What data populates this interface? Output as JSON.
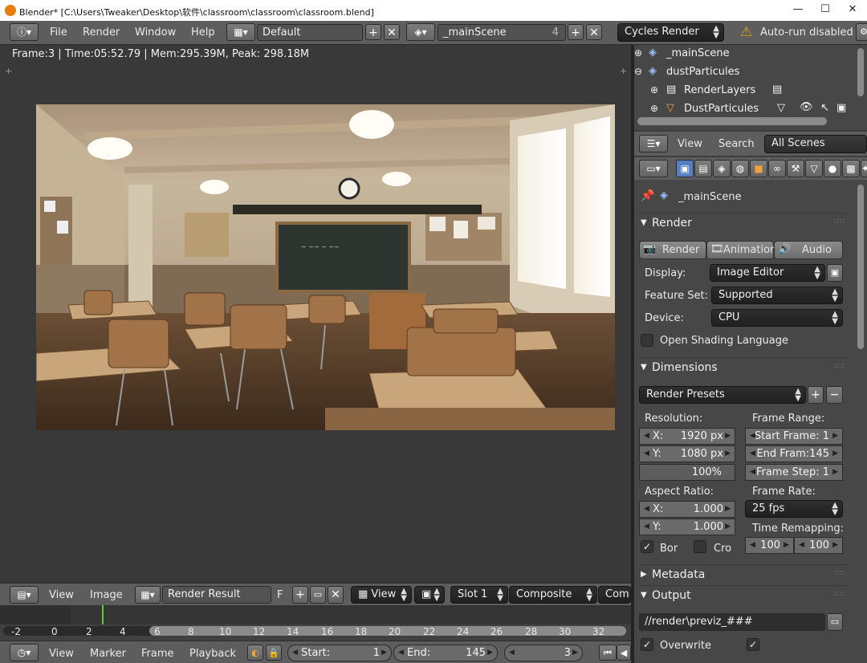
{
  "window": {
    "title": "Blender* [C:\\Users\\Tweaker\\Desktop\\软件\\classroom\\classroom\\classroom.blend]",
    "minimize": "—",
    "maximize": "☐",
    "close": "✕"
  },
  "menu": {
    "file": "File",
    "render": "Render",
    "window": "Window",
    "help": "Help"
  },
  "screen_layout": "Default",
  "scene": {
    "name": "_mainScene",
    "users": "4"
  },
  "engine": "Cycles Render",
  "autorun": "Auto-run disabled",
  "info": "Frame:3 | Time:05:52.79 | Mem:295.39M, Peak: 298.18M",
  "outliner": {
    "items": [
      "_mainScene",
      "dustParticules",
      "RenderLayers",
      "DustParticules"
    ]
  },
  "outliner_header": {
    "view": "View",
    "search": "Search",
    "filter": "All Scenes"
  },
  "props": {
    "context": "_mainScene",
    "render_panel": {
      "title": "Render",
      "render_btn": "Render",
      "animation_btn": "Animation",
      "audio_btn": "Audio",
      "display_label": "Display:",
      "display_value": "Image Editor",
      "feature_label": "Feature Set:",
      "feature_value": "Supported",
      "device_label": "Device:",
      "device_value": "CPU",
      "osl_label": "Open Shading Language"
    },
    "dimensions": {
      "title": "Dimensions",
      "presets": "Render Presets",
      "resolution_label": "Resolution:",
      "res_x_key": "X:",
      "res_x": "1920 px",
      "res_y_key": "Y:",
      "res_y": "1080 px",
      "res_pct": "100%",
      "frame_range_label": "Frame Range:",
      "start": "Start Frame: 1",
      "end": "End Fram:145",
      "step": "Frame Step: 1",
      "aspect_label": "Aspect Ratio:",
      "asp_x_key": "X:",
      "asp_x": "1.000",
      "asp_y_key": "Y:",
      "asp_y": "1.000",
      "framerate_label": "Frame Rate:",
      "framerate": "25 fps",
      "remap_label": "Time Remapping:",
      "remap_old": "100",
      "remap_new": "100",
      "border": "Bor",
      "crop": "Cro"
    },
    "metadata": {
      "title": "Metadata"
    },
    "output": {
      "title": "Output",
      "path": "//render\\previz_###",
      "overwrite": "Overwrite"
    }
  },
  "image_editor_header": {
    "view": "View",
    "image": "Image",
    "image_name": "Render Result",
    "fake": "F",
    "view2": "View",
    "slot": "Slot 1",
    "pass": "Composite",
    "layer": "Comb"
  },
  "timeline": {
    "ticks": [
      "-2",
      "0",
      "2",
      "4",
      "6",
      "8",
      "10",
      "12",
      "14",
      "16",
      "18",
      "20",
      "22",
      "24",
      "26",
      "28",
      "30",
      "32"
    ],
    "current": 3
  },
  "timeline_header": {
    "view": "View",
    "marker": "Marker",
    "frame": "Frame",
    "playback": "Playback",
    "start_label": "Start:",
    "start": "1",
    "end_label": "End:",
    "end": "145",
    "current": "3"
  },
  "colors": {
    "accent_blue": "#5680c2",
    "warning": "#e0a020",
    "playhead": "#5bcc3b"
  }
}
